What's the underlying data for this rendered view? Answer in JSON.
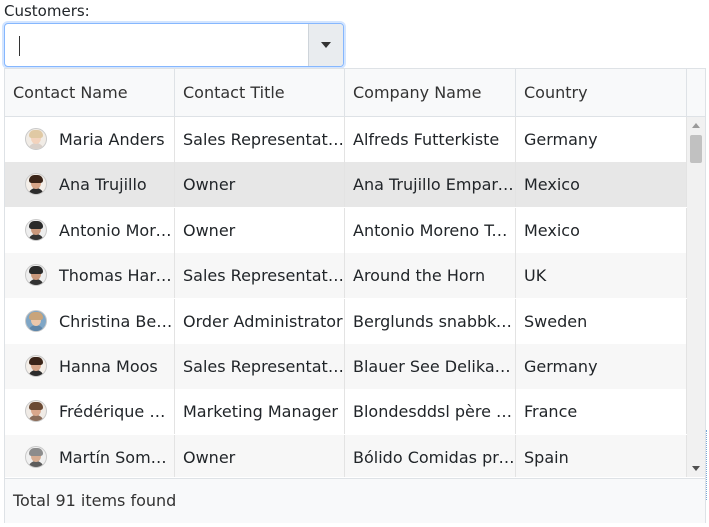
{
  "label": "Customers:",
  "combo": {
    "value": ""
  },
  "columns": [
    "Contact Name",
    "Contact Title",
    "Company Name",
    "Country"
  ],
  "rows": [
    {
      "contact_name": "Maria Anders",
      "contact_title": "Sales Representative",
      "company_name": "Alfreds Futterkiste",
      "country": "Germany",
      "avatar": "woman-avatar-blonde"
    },
    {
      "contact_name": "Ana Trujillo",
      "contact_title": "Owner",
      "company_name": "Ana Trujillo Emparedados y helados",
      "country": "Mexico",
      "avatar": "woman-avatar-dark-hair"
    },
    {
      "contact_name": "Antonio Moreno",
      "contact_title": "Owner",
      "company_name": "Antonio Moreno Taquería",
      "country": "Mexico",
      "avatar": "man-avatar-dark-hair"
    },
    {
      "contact_name": "Thomas Hardy",
      "contact_title": "Sales Representative",
      "company_name": "Around the Horn",
      "country": "UK",
      "avatar": "man-avatar-dark-hair"
    },
    {
      "contact_name": "Christina Berglund",
      "contact_title": "Order Administrator",
      "company_name": "Berglunds snabbköp",
      "country": "Sweden",
      "avatar": "woman-avatar-light"
    },
    {
      "contact_name": "Hanna Moos",
      "contact_title": "Sales Representative",
      "company_name": "Blauer See Delikatessen",
      "country": "Germany",
      "avatar": "woman-avatar-dark-hair"
    },
    {
      "contact_name": "Frédérique Citeaux",
      "contact_title": "Marketing Manager",
      "company_name": "Blondesddsl père et fils",
      "country": "France",
      "avatar": "man-avatar-brown-hair"
    },
    {
      "contact_name": "Martín Sommer",
      "contact_title": "Owner",
      "company_name": "Bólido Comidas preparadas",
      "country": "Spain",
      "avatar": "man-avatar-gray-hair"
    }
  ],
  "footer": {
    "text": "Total 91 items found"
  },
  "colors": {
    "accent_border": "#86b7fe",
    "selected_row": "#e7e7e7",
    "alt_row": "#f7f7f7",
    "header_bg": "#f8f9fa"
  }
}
